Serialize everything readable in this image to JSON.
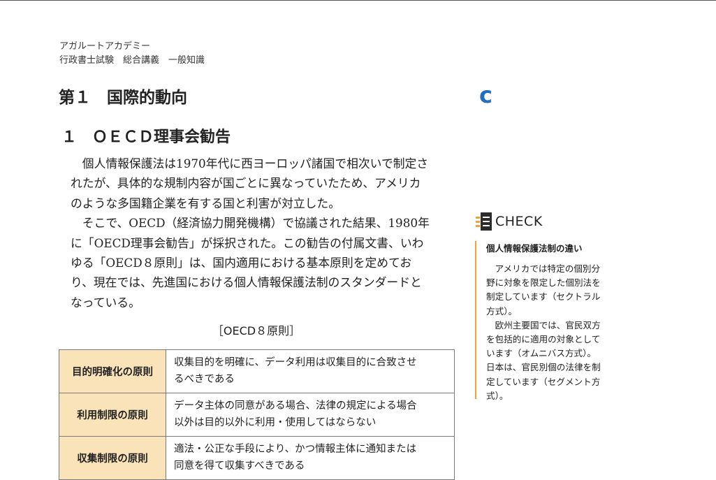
{
  "header": {
    "line1": "アガルートアカデミー",
    "line2": "行政書士試験　総合講義　一般知識"
  },
  "chapter_title": "第１　国際的動向",
  "logo_letter": "c",
  "section_title": "１　ＯＥＣＤ理事会勧告",
  "body_lines": [
    "　個人情報保護法は1970年代に西ヨーロッパ諸国で相次いで制定さ",
    "れたが、具体的な規制内容が国ごとに異なっていたため、アメリカ",
    "のような多国籍企業を有する国と利害が対立した。",
    "　そこで、OECD（経済協力開発機構）で協議された結果、1980年",
    "に「OECD理事会勧告」が採択された。この勧告の付属文書、いわ",
    "ゆる「OECD８原則」は、国内適用における基本原則を定めてお",
    "り、現在では、先進国における個人情報保護法制のスタンダードと",
    "なっている。"
  ],
  "table": {
    "title": "［OECD８原則］",
    "rows": [
      {
        "name": "目的明確化の原則",
        "desc_lines": [
          "収集目的を明確に、データ利用は収集目的に合致させ",
          "るべきである"
        ]
      },
      {
        "name": "利用制限の原則",
        "desc_lines": [
          "データ主体の同意がある場合、法律の規定による場合",
          "以外は目的以外に利用・使用してはならない"
        ]
      },
      {
        "name": "収集制限の原則",
        "desc_lines": [
          "適法・公正な手段により、かつ情報主体に通知または",
          "同意を得て収集すべきである"
        ]
      }
    ]
  },
  "check": {
    "label": "CHECK",
    "title": "個人情報保護法制の違い",
    "body_lines": [
      "　アメリカでは特定の個別分",
      "野に対象を限定した個別法を",
      "制定しています（セクトラル",
      "方式）。",
      "　欧州主要国では、官民双方",
      "を包括的に適用の対象として",
      "います（オムニバス方式）。",
      "日本は、官民別個の法律を制",
      "定しています（セグメント方",
      "式）。"
    ]
  },
  "colors": {
    "accent_blue": "#1f6fc0",
    "table_header_fill": "#fae3b9",
    "check_rule": "#f0a236"
  },
  "icons": {
    "check": "checklist-icon"
  }
}
